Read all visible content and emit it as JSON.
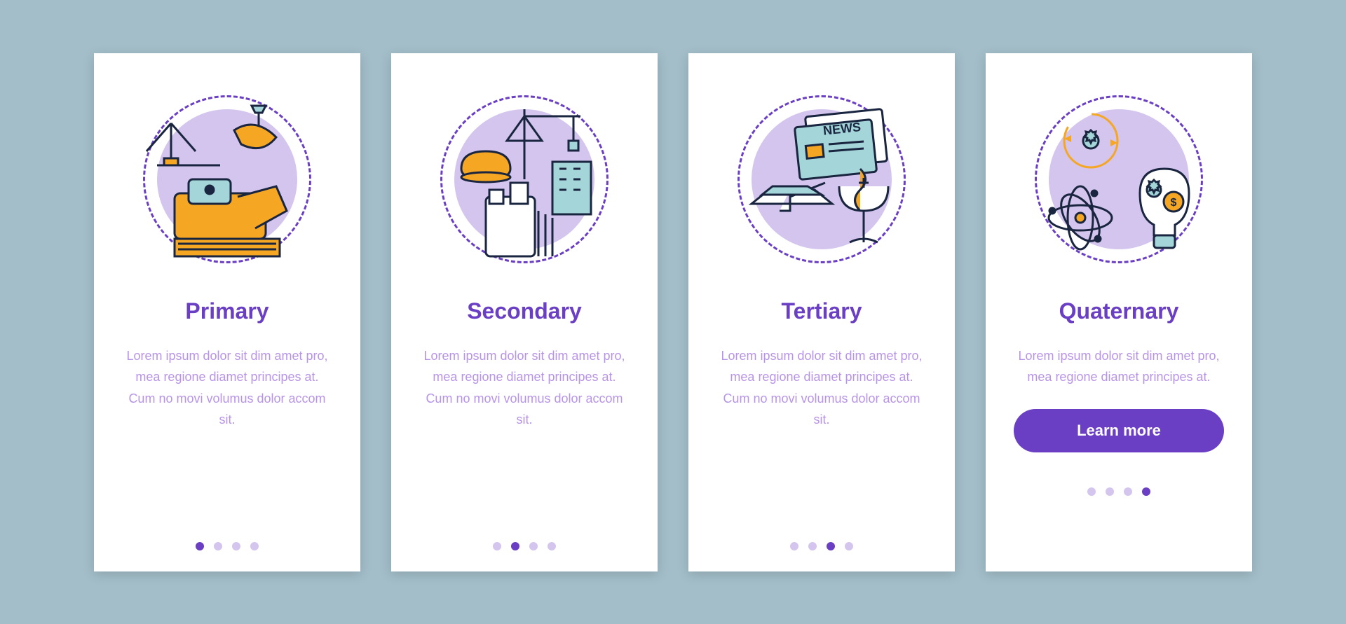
{
  "cards": [
    {
      "title": "Primary",
      "desc": "Lorem ipsum dolor sit dim amet pro, mea regione diamet principes at. Cum no movi volumus dolor accom sit.",
      "icon": "primary-industry-icon",
      "activeDot": 0,
      "hasButton": false
    },
    {
      "title": "Secondary",
      "desc": "Lorem ipsum dolor sit dim amet pro, mea regione diamet principes at. Cum no movi volumus dolor accom sit.",
      "icon": "secondary-industry-icon",
      "activeDot": 1,
      "hasButton": false
    },
    {
      "title": "Tertiary",
      "desc": "Lorem ipsum dolor sit dim amet pro, mea regione diamet principes at. Cum no movi volumus dolor accom sit.",
      "icon": "tertiary-industry-icon",
      "activeDot": 2,
      "hasButton": false
    },
    {
      "title": "Quaternary",
      "desc": "Lorem ipsum dolor sit dim amet pro, mea regione diamet principes at.",
      "icon": "quaternary-industry-icon",
      "activeDot": 3,
      "hasButton": true
    }
  ],
  "button_label": "Learn more",
  "colors": {
    "accent": "#6a3fc4",
    "light_purple": "#d4c5ee",
    "text_light": "#b794e6",
    "orange": "#f5a623",
    "teal": "#a3d5d9",
    "bg": "#a3bec9"
  },
  "dot_count": 4
}
